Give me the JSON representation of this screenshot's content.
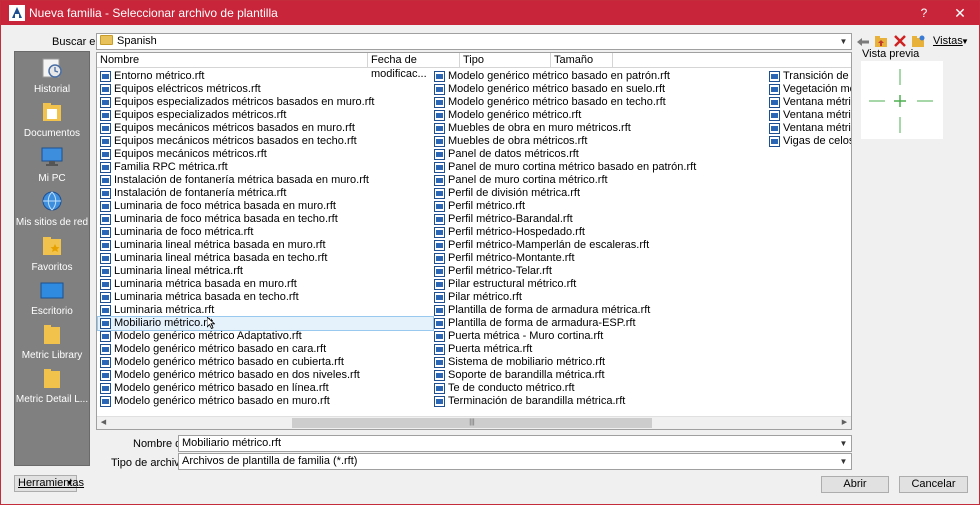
{
  "window": {
    "title": "Nueva familia - Seleccionar archivo de plantilla",
    "help": "?",
    "close": "✕"
  },
  "lookin": {
    "label": "Buscar en:",
    "value": "Spanish"
  },
  "toolbar": {
    "views_label": "Vistas"
  },
  "places": [
    {
      "label": "Historial",
      "icon": "history-icon"
    },
    {
      "label": "Documentos",
      "icon": "documents-icon"
    },
    {
      "label": "Mi PC",
      "icon": "computer-icon"
    },
    {
      "label": "Mis sitios de red",
      "icon": "network-icon"
    },
    {
      "label": "Favoritos",
      "icon": "favorites-icon"
    },
    {
      "label": "Escritorio",
      "icon": "desktop-icon"
    },
    {
      "label": "Metric Library",
      "icon": "folder-icon"
    },
    {
      "label": "Metric Detail L...",
      "icon": "folder-icon"
    }
  ],
  "columns": [
    "Nombre",
    "Fecha de modificac...",
    "Tipo",
    "Tamaño"
  ],
  "files": {
    "col1": [
      "Entorno métrico.rft",
      "Equipos eléctricos métricos.rft",
      "Equipos especializados métricos basados en muro.rft",
      "Equipos especializados métricos.rft",
      "Equipos mecánicos métricos basados en muro.rft",
      "Equipos mecánicos métricos basados en techo.rft",
      "Equipos mecánicos métricos.rft",
      "Familia RPC métrica.rft",
      "Instalación de fontanería métrica basada en muro.rft",
      "Instalación de fontanería métrica.rft",
      "Luminaria de foco métrica basada en muro.rft",
      "Luminaria de foco métrica basada en techo.rft",
      "Luminaria de foco métrica.rft",
      "Luminaria lineal métrica basada en muro.rft",
      "Luminaria lineal métrica basada en techo.rft",
      "Luminaria lineal métrica.rft",
      "Luminaria métrica basada en muro.rft",
      "Luminaria métrica basada en techo.rft",
      "Luminaria métrica.rft",
      "Mobiliario métrico.rft",
      "Modelo genérico métrico Adaptativo.rft",
      "Modelo genérico métrico basado en cara.rft",
      "Modelo genérico métrico basado en cubierta.rft",
      "Modelo genérico métrico basado en dos niveles.rft",
      "Modelo genérico métrico basado en línea.rft",
      "Modelo genérico métrico basado en muro.rft"
    ],
    "col2": [
      "Modelo genérico métrico basado en patrón.rft",
      "Modelo genérico métrico basado en suelo.rft",
      "Modelo genérico métrico basado en techo.rft",
      "Modelo genérico métrico.rft",
      "Muebles de obra en muro métricos.rft",
      "Muebles de obra métricos.rft",
      "Panel de datos métricos.rft",
      "Panel de muro cortina métrico basado en patrón.rft",
      "Panel de muro cortina métrico.rft",
      "Perfil de división métrica.rft",
      "Perfil métrico.rft",
      "Perfil métrico-Barandal.rft",
      "Perfil métrico-Hospedado.rft",
      "Perfil métrico-Mamperlán de escaleras.rft",
      "Perfil métrico-Montante.rft",
      "Perfil métrico-Telar.rft",
      "Pilar estructural métrico.rft",
      "Pilar métrico.rft",
      "Plantilla de forma de armadura métrica.rft",
      "Plantilla de forma de armadura-ESP.rft",
      "Puerta métrica - Muro cortina.rft",
      "Puerta métrica.rft",
      "Sistema de mobiliario métrico.rft",
      "Soporte de barandilla métrica.rft",
      "Te de conducto métrico.rft",
      "Terminación de barandilla métrica.rft"
    ],
    "col3": [
      "Transición de con",
      "Vegetación métric",
      "Ventana métrica -",
      "Ventana métrica c",
      "Ventana métrica.r",
      "Vigas de celosía c"
    ]
  },
  "selected_file": "Mobiliario métrico.rft",
  "preview": {
    "label": "Vista previa"
  },
  "filename": {
    "label": "Nombre de",
    "value": "Mobiliario métrico.rft"
  },
  "filetype": {
    "label": "Tipo de archivos:",
    "value": "Archivos de plantilla de familia  (*.rft)"
  },
  "buttons": {
    "tools": "Herramientas",
    "open": "Abrir",
    "cancel": "Cancelar"
  },
  "colors": {
    "titlebar": "#c8253a",
    "places_bg": "#808080",
    "selection": "#e5f1fb"
  }
}
